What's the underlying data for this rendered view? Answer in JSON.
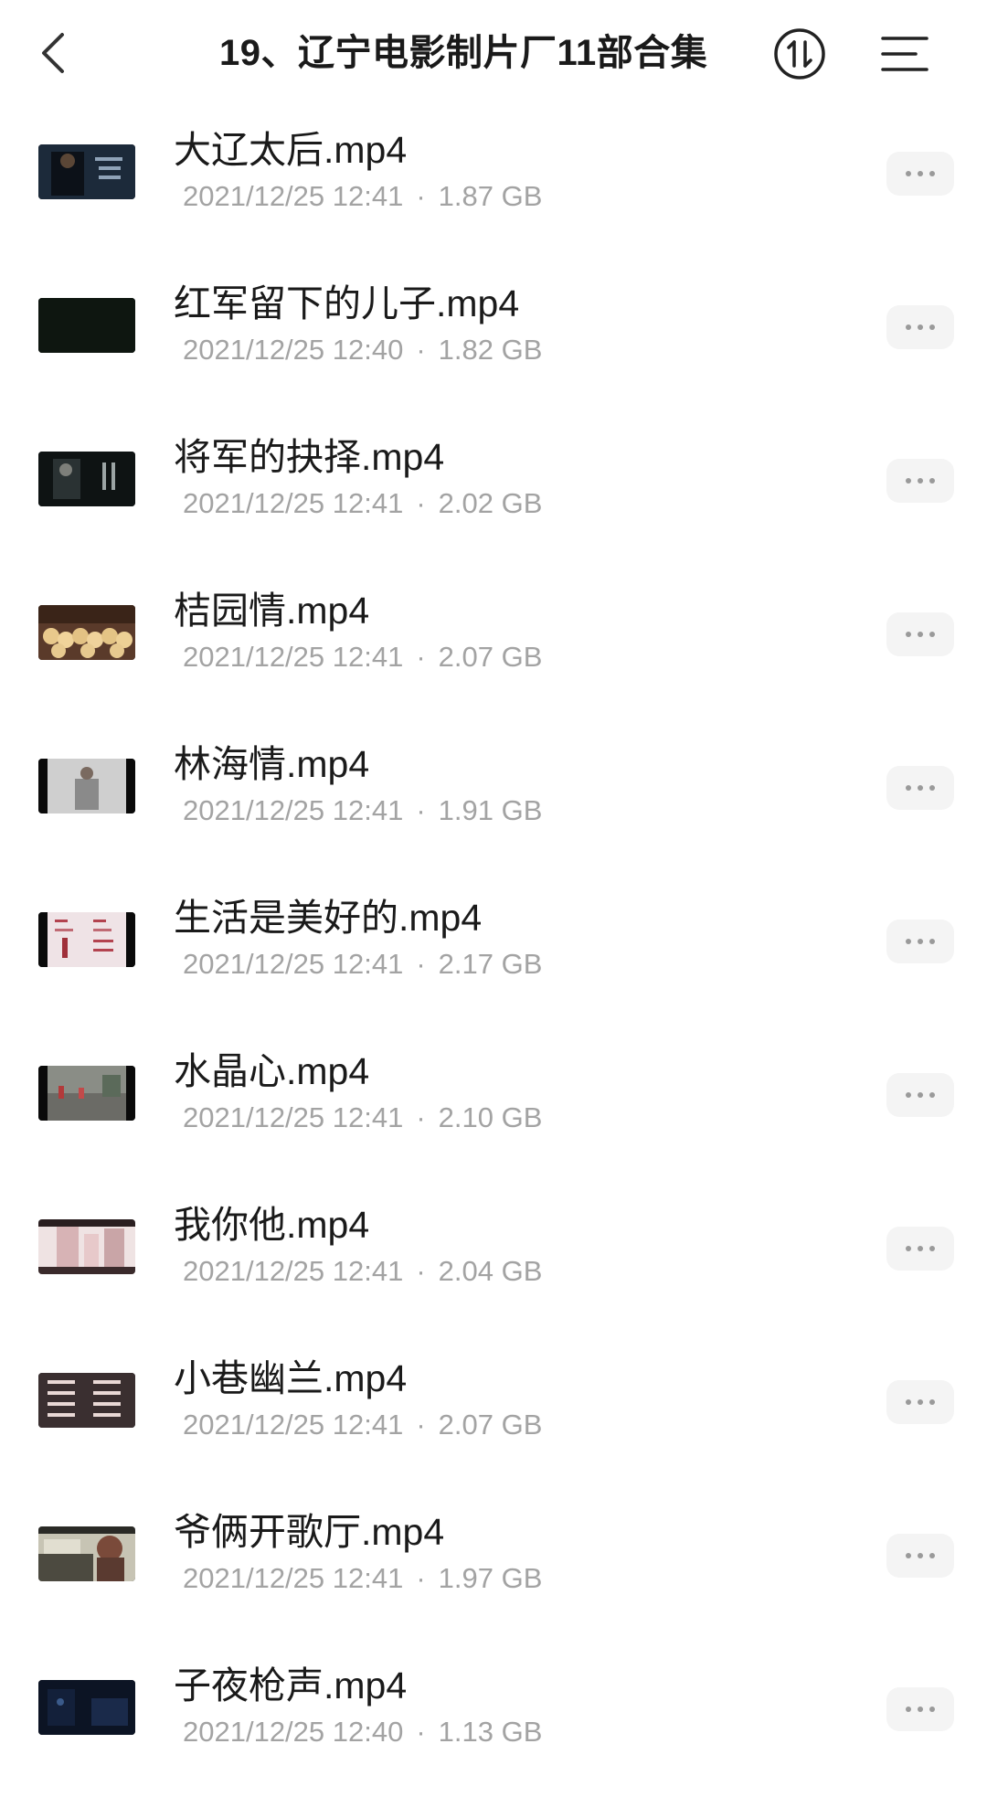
{
  "header": {
    "title": "19、辽宁电影制片厂11部合集",
    "back_icon": "chevron-left-icon",
    "sort_icon": "sort-arrows-icon",
    "menu_icon": "list-menu-icon"
  },
  "files": [
    {
      "name": "大辽太后.mp4",
      "date": "2021/12/25 12:41",
      "size": "1.87 GB",
      "thumb": "dark-blue-figure"
    },
    {
      "name": "红军留下的儿子.mp4",
      "date": "2021/12/25 12:40",
      "size": "1.82 GB",
      "thumb": "black-frame"
    },
    {
      "name": "将军的抉择.mp4",
      "date": "2021/12/25 12:41",
      "size": "2.02 GB",
      "thumb": "dark-credits"
    },
    {
      "name": "桔园情.mp4",
      "date": "2021/12/25 12:41",
      "size": "2.07 GB",
      "thumb": "oranges"
    },
    {
      "name": "林海情.mp4",
      "date": "2021/12/25 12:41",
      "size": "1.91 GB",
      "thumb": "grey-figure"
    },
    {
      "name": "生活是美好的.mp4",
      "date": "2021/12/25 12:41",
      "size": "2.17 GB",
      "thumb": "pink-credits"
    },
    {
      "name": "水晶心.mp4",
      "date": "2021/12/25 12:41",
      "size": "2.10 GB",
      "thumb": "street"
    },
    {
      "name": "我你他.mp4",
      "date": "2021/12/25 12:41",
      "size": "2.04 GB",
      "thumb": "buildings"
    },
    {
      "name": "小巷幽兰.mp4",
      "date": "2021/12/25 12:41",
      "size": "2.07 GB",
      "thumb": "credits-text"
    },
    {
      "name": "爷俩开歌厅.mp4",
      "date": "2021/12/25 12:41",
      "size": "1.97 GB",
      "thumb": "car-woman"
    },
    {
      "name": "子夜枪声.mp4",
      "date": "2021/12/25 12:40",
      "size": "1.13 GB",
      "thumb": "night-blue"
    }
  ],
  "colors": {
    "meta_text": "#a3a3a3",
    "title_text": "#1a1a1a",
    "more_bg": "#f4f4f4"
  }
}
